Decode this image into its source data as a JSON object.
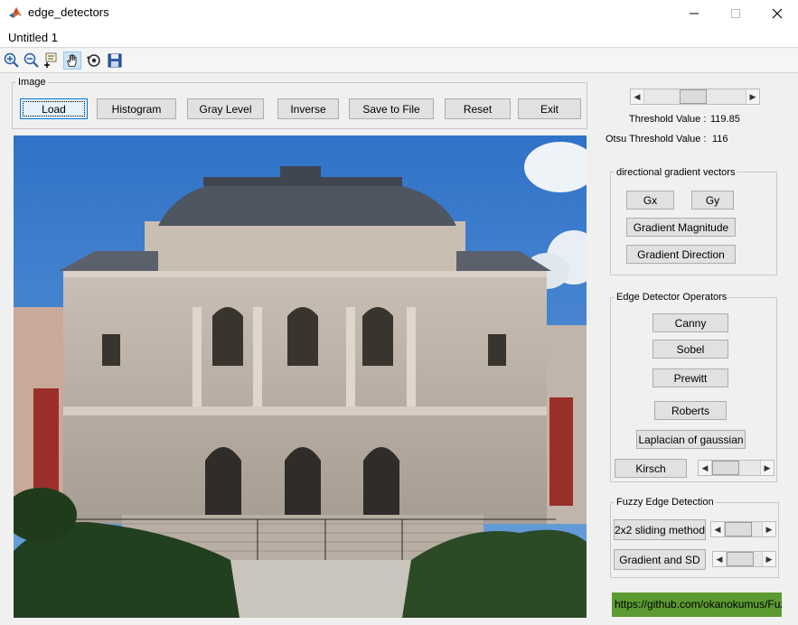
{
  "window": {
    "title": "edge_detectors",
    "menu_item": "Untitled 1"
  },
  "toolbar": {
    "icons": [
      "zoom-in-icon",
      "zoom-out-icon",
      "data-cursor-icon",
      "pan-hand-icon",
      "rotate-3d-icon",
      "save-icon"
    ]
  },
  "image_group": {
    "label": "Image",
    "buttons": {
      "load": "Load",
      "histogram": "Histogram",
      "gray_level": "Gray Level",
      "inverse": "Inverse",
      "save_to_file": "Save to File",
      "reset": "Reset",
      "exit": "Exit"
    }
  },
  "threshold": {
    "label": "Threshold Value :",
    "value": "119.85",
    "otsu_label": "Otsu Threshold Value :",
    "otsu_value": "116",
    "slider_fraction": 0.47
  },
  "gradient_group": {
    "label": "directional gradient vectors",
    "buttons": {
      "gx": "Gx",
      "gy": "Gy",
      "magnitude": "Gradient Magnitude",
      "direction": "Gradient Direction"
    }
  },
  "operators_group": {
    "label": "Edge Detector Operators",
    "buttons": {
      "canny": "Canny",
      "sobel": "Sobel",
      "prewitt": "Prewitt",
      "roberts": "Roberts",
      "log": "Laplacian of gaussian",
      "kirsch": "Kirsch"
    },
    "kirsch_slider_fraction": 0.0
  },
  "fuzzy_group": {
    "label": "Fuzzy Edge Detection",
    "buttons": {
      "sliding": "2x2 sliding method",
      "gradient_sd": "Gradient and SD"
    },
    "sliding_slider_fraction": 0.0,
    "gradient_sd_slider_fraction": 0.0
  },
  "link": {
    "url": "https://github.com/okanokumus/Fuzzy_"
  },
  "colors": {
    "link_bg": "#5c9a32",
    "focus": "#0078d7",
    "sky": "#3d7fd0"
  }
}
